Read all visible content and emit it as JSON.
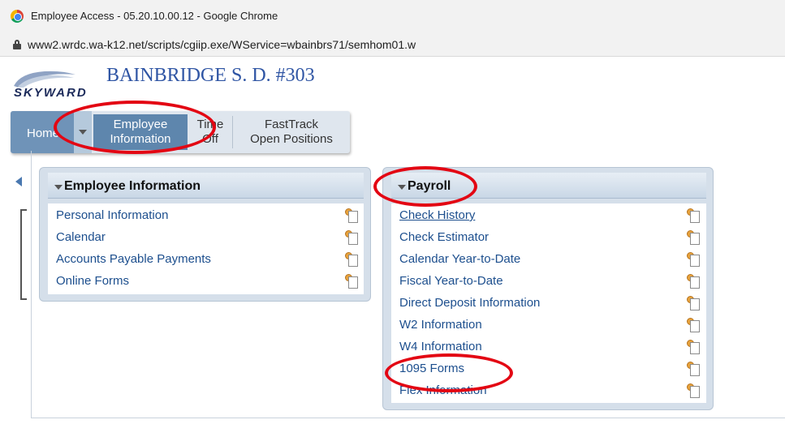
{
  "window": {
    "title": "Employee Access - 05.20.10.00.12 - Google Chrome"
  },
  "address": {
    "url": "www2.wrdc.wa-k12.net/scripts/cgiip.exe/WService=wbainbrs71/semhom01.w"
  },
  "header": {
    "logo_text": "SKYWARD",
    "district": "BAINBRIDGE S. D. #303"
  },
  "nav": {
    "home": "Home",
    "employee_line1": "Employee",
    "employee_line2": "Information",
    "time_line1": "Time",
    "time_line2": "Off",
    "fasttrack_line1": "FastTrack",
    "fasttrack_line2": "Open Positions"
  },
  "employee_panel": {
    "title": "Employee Information",
    "items": [
      {
        "label": "Personal Information"
      },
      {
        "label": "Calendar"
      },
      {
        "label": "Accounts Payable Payments"
      },
      {
        "label": "Online Forms"
      }
    ]
  },
  "payroll_panel": {
    "title": "Payroll",
    "items": [
      {
        "label": "Check History"
      },
      {
        "label": "Check Estimator"
      },
      {
        "label": "Calendar Year-to-Date"
      },
      {
        "label": "Fiscal Year-to-Date"
      },
      {
        "label": "Direct Deposit Information"
      },
      {
        "label": "W2 Information"
      },
      {
        "label": "W4 Information"
      },
      {
        "label": "1095 Forms"
      },
      {
        "label": "Flex Information"
      }
    ]
  },
  "colors": {
    "annotation": "#e30613",
    "link": "#1d4f8e",
    "nav_active": "#5e86ad"
  }
}
